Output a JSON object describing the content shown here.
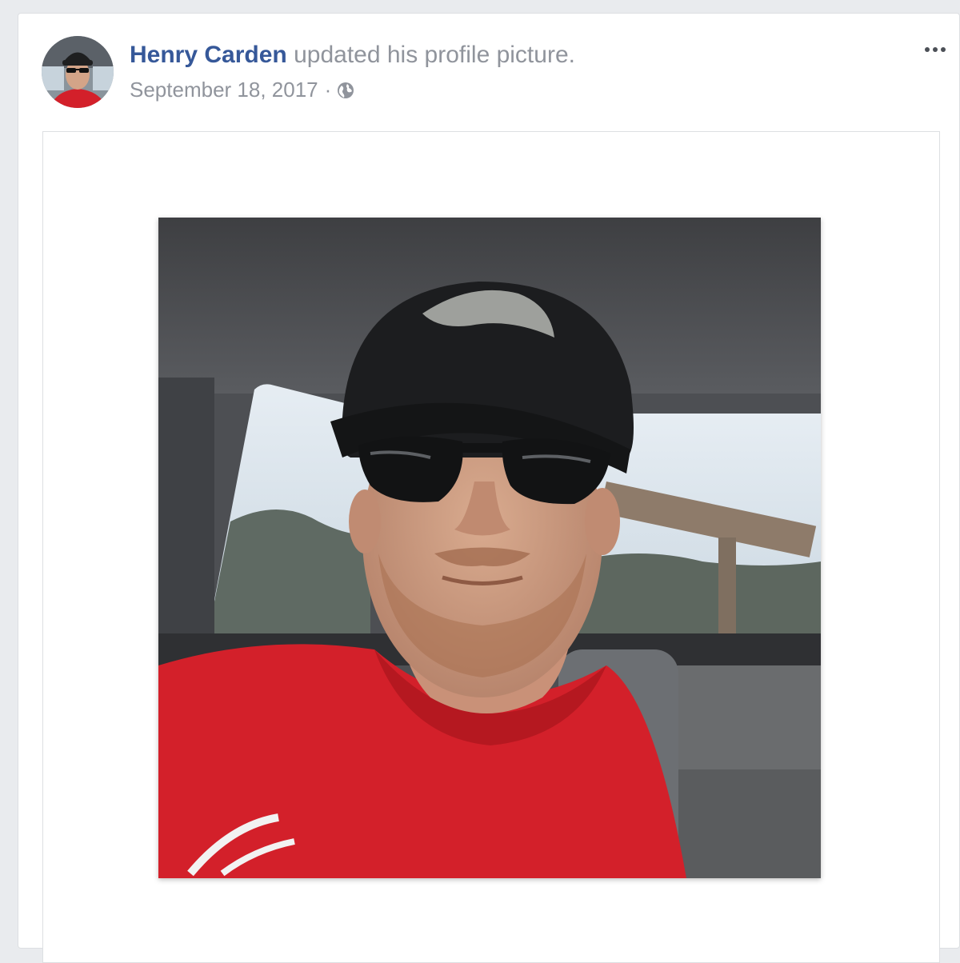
{
  "post": {
    "author_name": "Henry Carden",
    "action_text": "updated his profile picture.",
    "date": "September 18, 2017",
    "separator": "·",
    "privacy_icon": "globe-icon",
    "menu_icon": "more-options-icon"
  },
  "colors": {
    "page_background": "#e9ebee",
    "author_link": "#365899",
    "secondary_text": "#90949c",
    "shirt_red": "#d3202a"
  }
}
